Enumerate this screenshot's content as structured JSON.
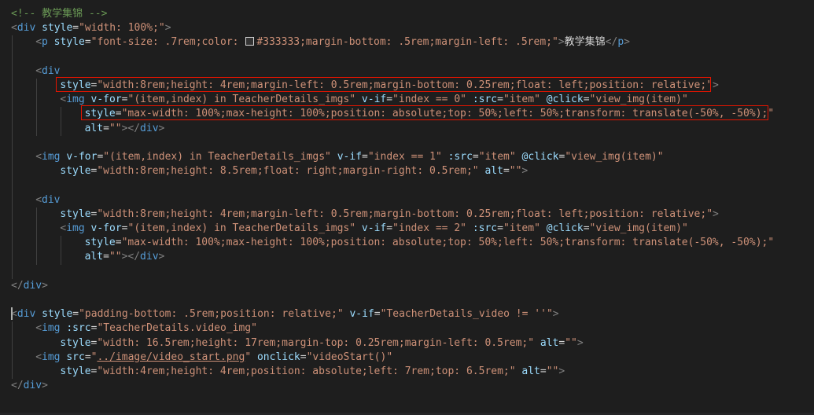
{
  "editor": {
    "background": "#1e1e1e",
    "theme_colors": {
      "comment": "#6a9955",
      "tag": "#569cd6",
      "attribute": "#9cdcfe",
      "string": "#ce9178",
      "punctuation": "#808080",
      "text": "#d4d4d4",
      "highlight_box": "#e51400",
      "color_swatch": "#333333"
    },
    "highlighted_lines": [
      5,
      7
    ],
    "lines": [
      {
        "indent": 0,
        "tokens": [
          [
            "comment",
            "<!-- 教学集锦 -->"
          ]
        ]
      },
      {
        "indent": 0,
        "tokens": [
          [
            "punc",
            "<"
          ],
          [
            "tag",
            "div"
          ],
          [
            "text",
            " "
          ],
          [
            "attr",
            "style"
          ],
          [
            "text",
            "="
          ],
          [
            "string",
            "\"width: 100%;\""
          ],
          [
            "punc",
            ">"
          ]
        ]
      },
      {
        "indent": 1,
        "tokens": [
          [
            "punc",
            "<"
          ],
          [
            "tag",
            "p"
          ],
          [
            "text",
            " "
          ],
          [
            "attr",
            "style"
          ],
          [
            "text",
            "="
          ],
          [
            "string",
            "\"font-size: .7rem;color: "
          ],
          [
            "swatch",
            ""
          ],
          [
            "string",
            "#333333;margin-bottom: .5rem;margin-left: .5rem;\""
          ],
          [
            "punc",
            ">"
          ],
          [
            "text",
            "教学集锦"
          ],
          [
            "punc",
            "</"
          ],
          [
            "tag",
            "p"
          ],
          [
            "punc",
            ">"
          ]
        ]
      },
      {
        "indent": 0,
        "tokens": []
      },
      {
        "indent": 1,
        "tokens": [
          [
            "punc",
            "<"
          ],
          [
            "tag",
            "div"
          ]
        ]
      },
      {
        "indent": 2,
        "tokens": [
          [
            "attr",
            "style"
          ],
          [
            "text",
            "="
          ],
          [
            "string",
            "\"width:8rem;height: 4rem;margin-left: 0.5rem;margin-bottom: 0.25rem;float: left;position: relative;\""
          ],
          [
            "punc",
            ">"
          ]
        ]
      },
      {
        "indent": 2,
        "tokens": [
          [
            "punc",
            "<"
          ],
          [
            "tag",
            "img"
          ],
          [
            "text",
            " "
          ],
          [
            "attr",
            "v-for"
          ],
          [
            "text",
            "="
          ],
          [
            "string",
            "\"(item,index) in TeacherDetails_imgs\""
          ],
          [
            "text",
            " "
          ],
          [
            "attr",
            "v-if"
          ],
          [
            "text",
            "="
          ],
          [
            "string",
            "\"index == 0\""
          ],
          [
            "text",
            " "
          ],
          [
            "attr",
            ":src"
          ],
          [
            "text",
            "="
          ],
          [
            "string",
            "\"item\""
          ],
          [
            "text",
            " "
          ],
          [
            "attr",
            "@click"
          ],
          [
            "text",
            "="
          ],
          [
            "string",
            "\"view_img(item)\""
          ]
        ]
      },
      {
        "indent": 3,
        "tokens": [
          [
            "attr",
            "style"
          ],
          [
            "text",
            "="
          ],
          [
            "string",
            "\"max-width: 100%;max-height: 100%;position: absolute;top: 50%;left: 50%;transform: translate(-50%, -50%);\""
          ]
        ]
      },
      {
        "indent": 3,
        "tokens": [
          [
            "attr",
            "alt"
          ],
          [
            "text",
            "="
          ],
          [
            "string",
            "\"\""
          ],
          [
            "punc",
            "></"
          ],
          [
            "tag",
            "div"
          ],
          [
            "punc",
            ">"
          ]
        ]
      },
      {
        "indent": 0,
        "tokens": []
      },
      {
        "indent": 1,
        "tokens": [
          [
            "punc",
            "<"
          ],
          [
            "tag",
            "img"
          ],
          [
            "text",
            " "
          ],
          [
            "attr",
            "v-for"
          ],
          [
            "text",
            "="
          ],
          [
            "string",
            "\"(item,index) in TeacherDetails_imgs\""
          ],
          [
            "text",
            " "
          ],
          [
            "attr",
            "v-if"
          ],
          [
            "text",
            "="
          ],
          [
            "string",
            "\"index == 1\""
          ],
          [
            "text",
            " "
          ],
          [
            "attr",
            ":src"
          ],
          [
            "text",
            "="
          ],
          [
            "string",
            "\"item\""
          ],
          [
            "text",
            " "
          ],
          [
            "attr",
            "@click"
          ],
          [
            "text",
            "="
          ],
          [
            "string",
            "\"view_img(item)\""
          ]
        ]
      },
      {
        "indent": 2,
        "tokens": [
          [
            "attr",
            "style"
          ],
          [
            "text",
            "="
          ],
          [
            "string",
            "\"width:8rem;height: 8.5rem;float: right;margin-right: 0.5rem;\""
          ],
          [
            "text",
            " "
          ],
          [
            "attr",
            "alt"
          ],
          [
            "text",
            "="
          ],
          [
            "string",
            "\"\""
          ],
          [
            "punc",
            ">"
          ]
        ]
      },
      {
        "indent": 0,
        "tokens": []
      },
      {
        "indent": 1,
        "tokens": [
          [
            "punc",
            "<"
          ],
          [
            "tag",
            "div"
          ]
        ]
      },
      {
        "indent": 2,
        "tokens": [
          [
            "attr",
            "style"
          ],
          [
            "text",
            "="
          ],
          [
            "string",
            "\"width:8rem;height: 4rem;margin-left: 0.5rem;margin-bottom: 0.25rem;float: left;position: relative;\""
          ],
          [
            "punc",
            ">"
          ]
        ]
      },
      {
        "indent": 2,
        "tokens": [
          [
            "punc",
            "<"
          ],
          [
            "tag",
            "img"
          ],
          [
            "text",
            " "
          ],
          [
            "attr",
            "v-for"
          ],
          [
            "text",
            "="
          ],
          [
            "string",
            "\"(item,index) in TeacherDetails_imgs\""
          ],
          [
            "text",
            " "
          ],
          [
            "attr",
            "v-if"
          ],
          [
            "text",
            "="
          ],
          [
            "string",
            "\"index == 2\""
          ],
          [
            "text",
            " "
          ],
          [
            "attr",
            ":src"
          ],
          [
            "text",
            "="
          ],
          [
            "string",
            "\"item\""
          ],
          [
            "text",
            " "
          ],
          [
            "attr",
            "@click"
          ],
          [
            "text",
            "="
          ],
          [
            "string",
            "\"view_img(item)\""
          ]
        ]
      },
      {
        "indent": 3,
        "tokens": [
          [
            "attr",
            "style"
          ],
          [
            "text",
            "="
          ],
          [
            "string",
            "\"max-width: 100%;max-height: 100%;position: absolute;top: 50%;left: 50%;transform: translate(-50%, -50%);\""
          ]
        ]
      },
      {
        "indent": 3,
        "tokens": [
          [
            "attr",
            "alt"
          ],
          [
            "text",
            "="
          ],
          [
            "string",
            "\"\""
          ],
          [
            "punc",
            "></"
          ],
          [
            "tag",
            "div"
          ],
          [
            "punc",
            ">"
          ]
        ]
      },
      {
        "indent": 0,
        "tokens": []
      },
      {
        "indent": 0,
        "tokens": [
          [
            "punc",
            "</"
          ],
          [
            "tag",
            "div"
          ],
          [
            "punc",
            ">"
          ]
        ]
      },
      {
        "indent": 0,
        "tokens": []
      },
      {
        "indent": 0,
        "tokens": [
          [
            "punc",
            "<"
          ],
          [
            "tag",
            "div"
          ],
          [
            "text",
            " "
          ],
          [
            "attr",
            "style"
          ],
          [
            "text",
            "="
          ],
          [
            "string",
            "\"padding-bottom: .5rem;position: relative;\""
          ],
          [
            "text",
            " "
          ],
          [
            "attr",
            "v-if"
          ],
          [
            "text",
            "="
          ],
          [
            "string",
            "\"TeacherDetails_video != ''\""
          ],
          [
            "punc",
            ">"
          ]
        ]
      },
      {
        "indent": 1,
        "tokens": [
          [
            "punc",
            "<"
          ],
          [
            "tag",
            "img"
          ],
          [
            "text",
            " "
          ],
          [
            "attr",
            ":src"
          ],
          [
            "text",
            "="
          ],
          [
            "string",
            "\"TeacherDetails.video_img\""
          ]
        ]
      },
      {
        "indent": 2,
        "tokens": [
          [
            "attr",
            "style"
          ],
          [
            "text",
            "="
          ],
          [
            "string",
            "\"width: 16.5rem;height: 17rem;margin-top: 0.25rem;margin-left: 0.5rem;\""
          ],
          [
            "text",
            " "
          ],
          [
            "attr",
            "alt"
          ],
          [
            "text",
            "="
          ],
          [
            "string",
            "\"\""
          ],
          [
            "punc",
            ">"
          ]
        ]
      },
      {
        "indent": 1,
        "tokens": [
          [
            "punc",
            "<"
          ],
          [
            "tag",
            "img"
          ],
          [
            "text",
            " "
          ],
          [
            "attr",
            "src"
          ],
          [
            "text",
            "="
          ],
          [
            "string",
            "\""
          ],
          [
            "link",
            "../image/video_start.png"
          ],
          [
            "string",
            "\""
          ],
          [
            "text",
            " "
          ],
          [
            "attr",
            "onclick"
          ],
          [
            "text",
            "="
          ],
          [
            "string",
            "\"videoStart()\""
          ]
        ]
      },
      {
        "indent": 2,
        "tokens": [
          [
            "attr",
            "style"
          ],
          [
            "text",
            "="
          ],
          [
            "string",
            "\"width:4rem;height: 4rem;position: absolute;left: 7rem;top: 6.5rem;\""
          ],
          [
            "text",
            " "
          ],
          [
            "attr",
            "alt"
          ],
          [
            "text",
            "="
          ],
          [
            "string",
            "\"\""
          ],
          [
            "punc",
            ">"
          ]
        ]
      },
      {
        "indent": 0,
        "tokens": [
          [
            "punc",
            "</"
          ],
          [
            "tag",
            "div"
          ],
          [
            "punc",
            ">"
          ]
        ]
      }
    ]
  }
}
